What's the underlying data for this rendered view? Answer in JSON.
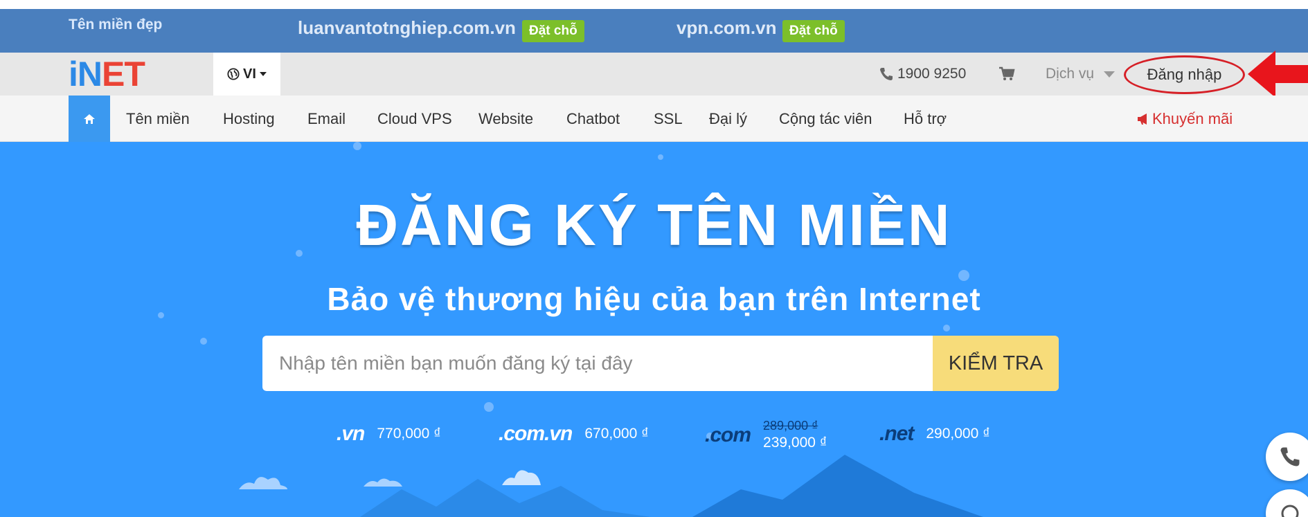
{
  "promo": {
    "label": "Tên miền đẹp",
    "domains": [
      {
        "name": "luanvantotnghiep.com.vn",
        "action": "Đặt chỗ"
      },
      {
        "name": "vpn.com.vn",
        "action": "Đặt chỗ"
      }
    ]
  },
  "header": {
    "logo_part1": "iN",
    "logo_part2": "ET",
    "language": "VI",
    "phone": "1900 9250",
    "service": "Dịch vụ",
    "login": "Đăng nhập"
  },
  "nav": {
    "items": [
      "Tên miền",
      "Hosting",
      "Email",
      "Cloud VPS",
      "Website",
      "Chatbot",
      "SSL",
      "Đại lý",
      "Cộng tác viên",
      "Hỗ trợ"
    ],
    "promo": "Khuyến mãi"
  },
  "hero": {
    "title": "ĐĂNG KÝ TÊN MIỀN",
    "subtitle": "Bảo vệ thương hiệu của bạn trên Internet",
    "search_placeholder": "Nhập tên miền bạn muốn đăng ký tại đây",
    "search_button": "KIỂM TRA",
    "tlds": [
      {
        "ext": ".vn",
        "price": "770,000 ₫"
      },
      {
        "ext": ".com.vn",
        "price": "670,000 ₫"
      },
      {
        "ext": ".com",
        "old_price": "289,000 ₫",
        "price": "239,000 ₫"
      },
      {
        "ext": ".net",
        "price": "290,000 ₫"
      }
    ]
  },
  "colors": {
    "promo_bar": "#4a7fbe",
    "badge": "#7cbf2a",
    "hero": "#3399ff",
    "search_button": "#f7dc7a",
    "login_highlight": "#d61f26"
  }
}
